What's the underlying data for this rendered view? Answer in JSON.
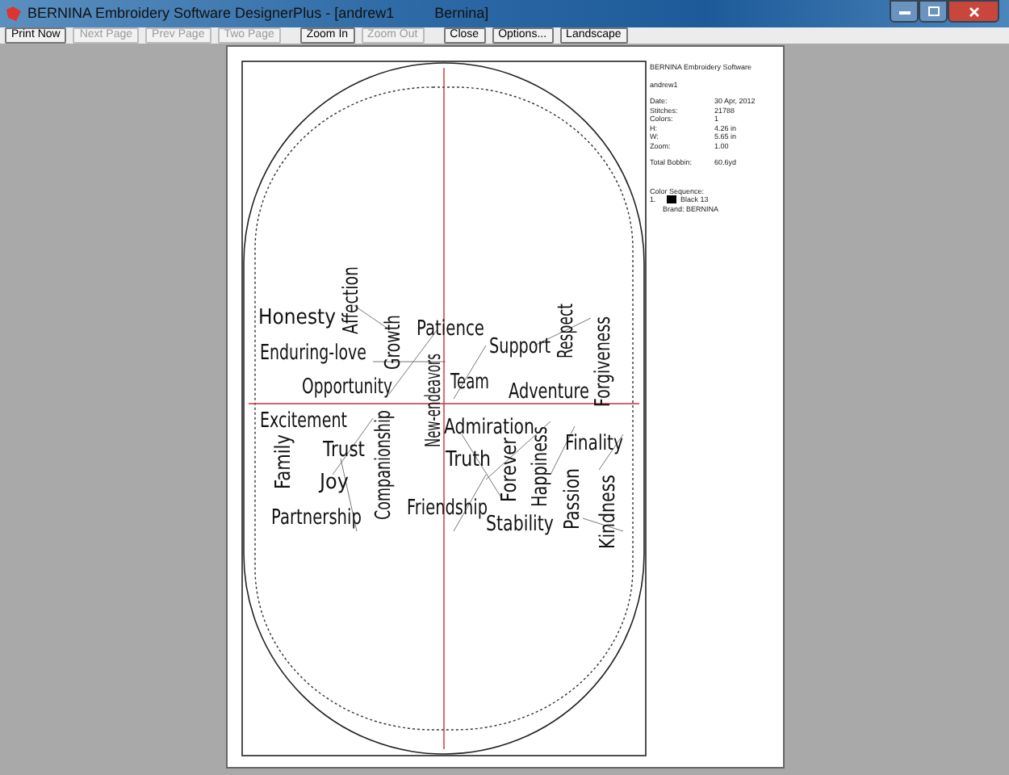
{
  "window": {
    "title": "BERNINA Embroidery Software DesignerPlus - [andrew1          Bernina]"
  },
  "toolbar": [
    {
      "label": "Print Now",
      "disabled": false
    },
    {
      "label": "Next Page",
      "disabled": true
    },
    {
      "label": "Prev Page",
      "disabled": true
    },
    {
      "label": "Two Page",
      "disabled": true
    },
    {
      "label": "Zoom In",
      "disabled": false
    },
    {
      "label": "Zoom Out",
      "disabled": true
    },
    {
      "label": "Close",
      "disabled": false
    },
    {
      "label": "Options...",
      "disabled": false
    },
    {
      "label": "Landscape",
      "disabled": false
    }
  ],
  "design": {
    "words": [
      {
        "text": "Honesty",
        "vertical": false
      },
      {
        "text": "Affection",
        "vertical": true
      },
      {
        "text": "Enduring-love",
        "vertical": false
      },
      {
        "text": "Growth",
        "vertical": true
      },
      {
        "text": "Patience",
        "vertical": false
      },
      {
        "text": "New-endeavors",
        "vertical": true
      },
      {
        "text": "Support",
        "vertical": false
      },
      {
        "text": "Respect",
        "vertical": true
      },
      {
        "text": "Forgiveness",
        "vertical": true
      },
      {
        "text": "Opportunity",
        "vertical": false
      },
      {
        "text": "Team",
        "vertical": false
      },
      {
        "text": "Adventure",
        "vertical": false
      },
      {
        "text": "Excitement",
        "vertical": false
      },
      {
        "text": "Companionship",
        "vertical": true
      },
      {
        "text": "Admiration",
        "vertical": false
      },
      {
        "text": "Trust",
        "vertical": false
      },
      {
        "text": "Family",
        "vertical": true
      },
      {
        "text": "Truth",
        "vertical": false
      },
      {
        "text": "Finality",
        "vertical": false
      },
      {
        "text": "Joy",
        "vertical": false
      },
      {
        "text": "Forever",
        "vertical": true
      },
      {
        "text": "Happiness",
        "vertical": true
      },
      {
        "text": "Partnership",
        "vertical": false
      },
      {
        "text": "Friendship",
        "vertical": false
      },
      {
        "text": "Passion",
        "vertical": true
      },
      {
        "text": "Stability",
        "vertical": false
      },
      {
        "text": "Kindness",
        "vertical": true
      }
    ]
  },
  "info": {
    "heading": "BERNINA Embroidery Software",
    "design_name": "andrew1",
    "fields": [
      {
        "label": "Date:",
        "value": "30 Apr, 2012"
      },
      {
        "label": "Stitches:",
        "value": "21788"
      },
      {
        "label": "Colors:",
        "value": "1"
      },
      {
        "label": "H:",
        "value": "4.26 in"
      },
      {
        "label": "W:",
        "value": "5.65 in"
      },
      {
        "label": "Zoom:",
        "value": "1.00"
      }
    ],
    "total": {
      "label": "Total Bobbin:",
      "value": "60.6yd"
    },
    "sequence_heading": "Color Sequence:",
    "colors": [
      {
        "number": "1.",
        "color": "#000000",
        "name": "Black 13",
        "brand": "Brand: BERNINA"
      }
    ]
  }
}
